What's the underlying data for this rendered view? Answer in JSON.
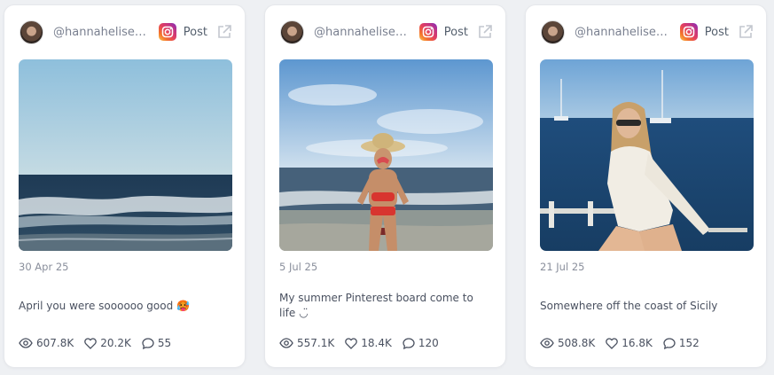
{
  "posts": [
    {
      "handle": "@hannahelisem...",
      "post_label": "Post",
      "date": "30 Apr 25",
      "caption": "April you were soooooo good 🥵",
      "views": "607.8K",
      "likes": "20.2K",
      "comments": "55"
    },
    {
      "handle": "@hannahelisem...",
      "post_label": "Post",
      "date": "5 Jul 25",
      "caption": "My summer Pinterest board come to life ◡̈",
      "views": "557.1K",
      "likes": "18.4K",
      "comments": "120"
    },
    {
      "handle": "@hannahelisem...",
      "post_label": "Post",
      "date": "21 Jul 25",
      "caption": "Somewhere off the coast of Sicily",
      "views": "508.8K",
      "likes": "16.8K",
      "comments": "152"
    }
  ],
  "icons": {
    "platform": "instagram-icon",
    "external": "external-link-icon",
    "views": "eye-icon",
    "likes": "heart-icon",
    "comments": "comment-icon"
  },
  "colors": {
    "background": "#eef0f3",
    "card": "#ffffff",
    "text": "#4a5160",
    "muted": "#8a8f9c"
  }
}
